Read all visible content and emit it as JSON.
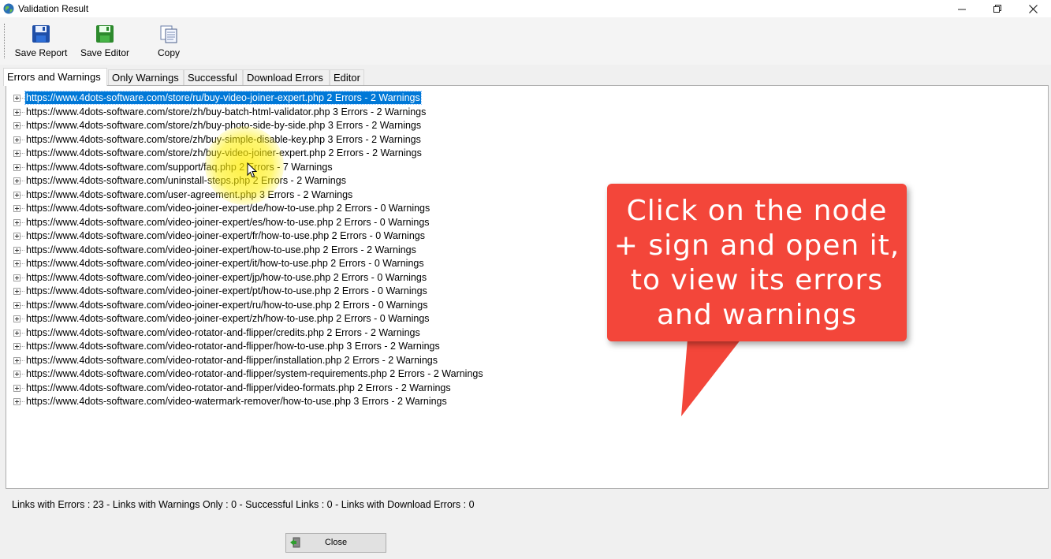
{
  "window": {
    "title": "Validation Result"
  },
  "toolbar": {
    "save_report_label": "Save Report",
    "save_editor_label": "Save Editor",
    "copy_label": "Copy"
  },
  "tabs": [
    {
      "label": "Errors and Warnings",
      "active": true
    },
    {
      "label": "Only Warnings",
      "active": false
    },
    {
      "label": "Successful",
      "active": false
    },
    {
      "label": "Download Errors",
      "active": false
    },
    {
      "label": "Editor",
      "active": false
    }
  ],
  "tree": {
    "items": [
      {
        "label": "https://www.4dots-software.com/store/ru/buy-video-joiner-expert.php 2 Errors - 2 Warnings",
        "selected": true
      },
      {
        "label": "https://www.4dots-software.com/store/zh/buy-batch-html-validator.php 3 Errors - 2 Warnings",
        "selected": false
      },
      {
        "label": "https://www.4dots-software.com/store/zh/buy-photo-side-by-side.php 3 Errors - 2 Warnings",
        "selected": false
      },
      {
        "label": "https://www.4dots-software.com/store/zh/buy-simple-disable-key.php 3 Errors - 2 Warnings",
        "selected": false
      },
      {
        "label": "https://www.4dots-software.com/store/zh/buy-video-joiner-expert.php 2 Errors - 2 Warnings",
        "selected": false
      },
      {
        "label": "https://www.4dots-software.com/support/faq.php 2 Errors - 7 Warnings",
        "selected": false
      },
      {
        "label": "https://www.4dots-software.com/uninstall-steps.php 2 Errors - 2 Warnings",
        "selected": false
      },
      {
        "label": "https://www.4dots-software.com/user-agreement.php 3 Errors - 2 Warnings",
        "selected": false
      },
      {
        "label": "https://www.4dots-software.com/video-joiner-expert/de/how-to-use.php 2 Errors - 0 Warnings",
        "selected": false
      },
      {
        "label": "https://www.4dots-software.com/video-joiner-expert/es/how-to-use.php 2 Errors - 0 Warnings",
        "selected": false
      },
      {
        "label": "https://www.4dots-software.com/video-joiner-expert/fr/how-to-use.php 2 Errors - 0 Warnings",
        "selected": false
      },
      {
        "label": "https://www.4dots-software.com/video-joiner-expert/how-to-use.php 2 Errors - 2 Warnings",
        "selected": false
      },
      {
        "label": "https://www.4dots-software.com/video-joiner-expert/it/how-to-use.php 2 Errors - 0 Warnings",
        "selected": false
      },
      {
        "label": "https://www.4dots-software.com/video-joiner-expert/jp/how-to-use.php 2 Errors - 0 Warnings",
        "selected": false
      },
      {
        "label": "https://www.4dots-software.com/video-joiner-expert/pt/how-to-use.php 2 Errors - 0 Warnings",
        "selected": false
      },
      {
        "label": "https://www.4dots-software.com/video-joiner-expert/ru/how-to-use.php 2 Errors - 0 Warnings",
        "selected": false
      },
      {
        "label": "https://www.4dots-software.com/video-joiner-expert/zh/how-to-use.php 2 Errors - 0 Warnings",
        "selected": false
      },
      {
        "label": "https://www.4dots-software.com/video-rotator-and-flipper/credits.php 2 Errors - 2 Warnings",
        "selected": false
      },
      {
        "label": "https://www.4dots-software.com/video-rotator-and-flipper/how-to-use.php 3 Errors - 2 Warnings",
        "selected": false
      },
      {
        "label": "https://www.4dots-software.com/video-rotator-and-flipper/installation.php 2 Errors - 2 Warnings",
        "selected": false
      },
      {
        "label": "https://www.4dots-software.com/video-rotator-and-flipper/system-requirements.php 2 Errors - 2 Warnings",
        "selected": false
      },
      {
        "label": "https://www.4dots-software.com/video-rotator-and-flipper/video-formats.php 2 Errors - 2 Warnings",
        "selected": false
      },
      {
        "label": "https://www.4dots-software.com/video-watermark-remover/how-to-use.php 3 Errors - 2 Warnings",
        "selected": false
      }
    ]
  },
  "callout": {
    "lines": [
      "Click on the node",
      "+ sign and open it,",
      "to view its errors",
      "and warnings"
    ],
    "color": "#f3463a"
  },
  "status": {
    "text": "Links with Errors : 23 - Links with Warnings Only : 0 - Successful Links : 0 - Links with Download Errors : 0"
  },
  "footer": {
    "close_label": "Close"
  },
  "colors": {
    "selection": "#0078d7",
    "highlight": "#ffeb00"
  }
}
